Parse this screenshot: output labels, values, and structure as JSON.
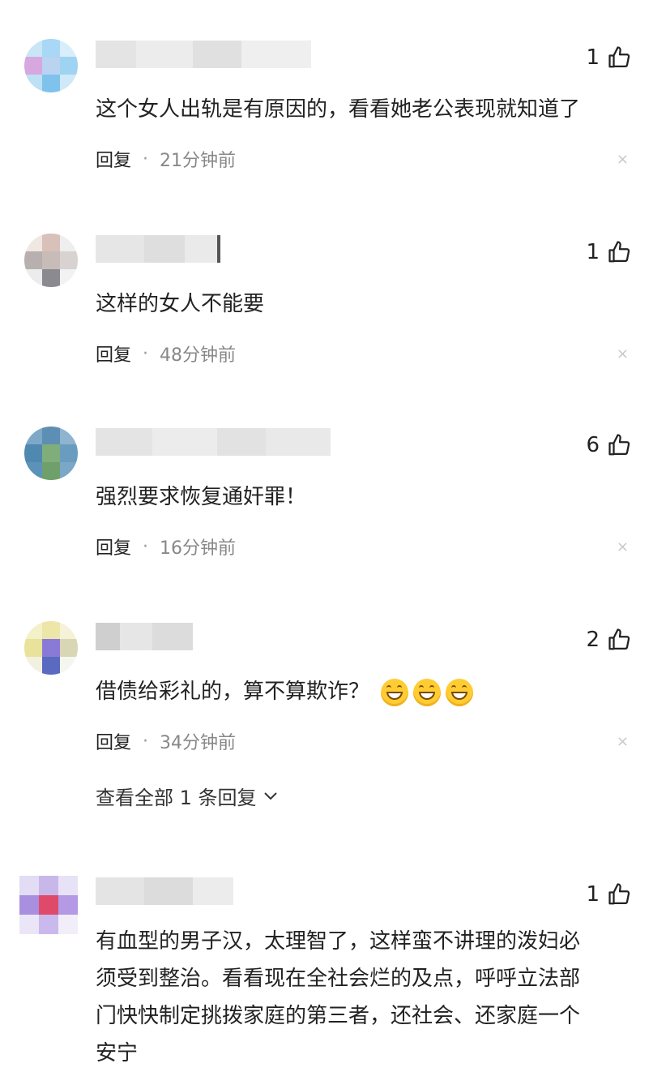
{
  "reply_label": "回复",
  "separator": "·",
  "close_glyph": "×",
  "comments": [
    {
      "likes": "1",
      "text": "这个女人出轨是有原因的，看看她老公表现就知道了",
      "time": "21分钟前"
    },
    {
      "likes": "1",
      "text": "这样的女人不能要",
      "time": "48分钟前"
    },
    {
      "likes": "6",
      "text": "强烈要求恢复通奸罪！",
      "time": "16分钟前"
    },
    {
      "likes": "2",
      "text": "借债给彩礼的，算不算欺诈？",
      "time": "34分钟前",
      "emoji": [
        "grin-emoji",
        "grin-emoji",
        "grin-emoji"
      ]
    },
    {
      "likes": "1",
      "text_lines": [
        "有血型的男子汉，太理智了，这样蛮不讲理的泼妇必",
        "须受到整治。看看现在全社会烂的及点，呼呼立法部",
        "门快快制定挑拨家庭的第三者，还社会、还家庭一个",
        "安宁"
      ]
    }
  ],
  "view_all_replies": "查看全部 1 条回复",
  "colors": {
    "text": "#222222",
    "meta": "#888888",
    "close": "#c8c8c8",
    "emoji": "#ffcc33"
  },
  "icons": [
    "thumbs-up-icon",
    "close-icon",
    "chevron-down-icon"
  ]
}
